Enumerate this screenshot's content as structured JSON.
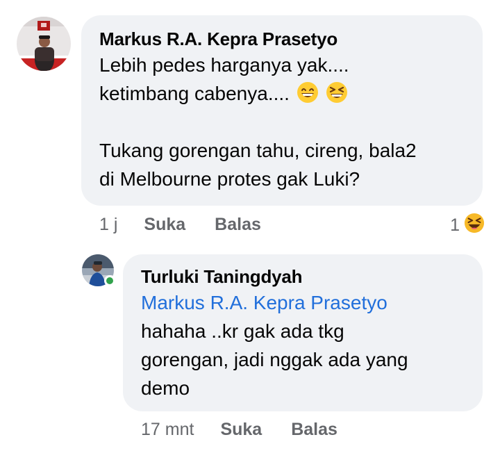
{
  "comment": {
    "author": "Markus R.A. Kepra Prasetyo",
    "line1": "Lebih pedes harganya yak....",
    "line2": "ketimbang cabenya....",
    "line2_emojis": [
      "grin-emoji",
      "laughing-emoji"
    ],
    "line3": "Tukang gorengan tahu, cireng, bala2",
    "line4": "di Melbourne protes gak Luki?",
    "time": "1 j",
    "like_label": "Suka",
    "reply_label": "Balas",
    "reaction_count": "1",
    "reaction_icon": "laughing-emoji"
  },
  "reply": {
    "author": "Turluki Taningdyah",
    "mention": "Markus R.A. Kepra Prasetyo",
    "line1": "hahaha ..kr gak ada tkg",
    "line2": "gorengan, jadi nggak ada yang",
    "line3": "demo",
    "time": "17 mnt",
    "like_label": "Suka",
    "reply_label": "Balas",
    "online_status_color": "#31a24c"
  },
  "colors": {
    "bubble": "#f0f2f5",
    "mention": "#216fdb",
    "meta": "#65676b"
  }
}
